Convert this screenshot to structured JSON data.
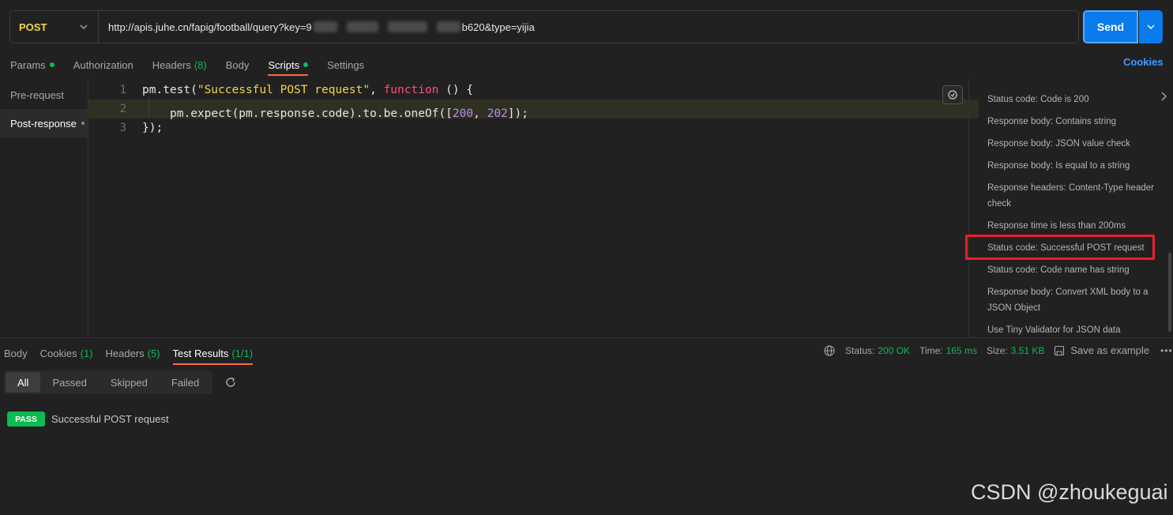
{
  "request": {
    "method": "POST",
    "url_prefix": "http://apis.juhe.cn/fapig/football/query?key=9",
    "url_suffix": "b620&type=yijia",
    "send_label": "Send"
  },
  "request_tabs": {
    "params": "Params",
    "authorization": "Authorization",
    "headers": "Headers",
    "headers_count": "(8)",
    "body": "Body",
    "scripts": "Scripts",
    "settings": "Settings",
    "cookies": "Cookies"
  },
  "scripts_sidebar": {
    "pre_request": "Pre-request",
    "post_response": "Post-response"
  },
  "code": {
    "lines": [
      "1",
      "2",
      "3"
    ],
    "l1_a": "pm.test(",
    "l1_str": "\"Successful POST request\"",
    "l1_b": ", ",
    "l1_kw": "function",
    "l1_c": " () {",
    "l2_a": "pm.expect(pm.response.code).to.be.oneOf([",
    "l2_n1": "200",
    "l2_b": ", ",
    "l2_n2": "202",
    "l2_c": "]);",
    "l3": "});"
  },
  "snippets": [
    "Status code: Code is 200",
    "Response body: Contains string",
    "Response body: JSON value check",
    "Response body: Is equal to a string",
    "Response headers: Content-Type header check",
    "Response time is less than 200ms",
    "Status code: Successful POST request",
    "Status code: Code name has string",
    "Response body: Convert XML body to a JSON Object",
    "Use Tiny Validator for JSON data"
  ],
  "response_tabs": {
    "body": "Body",
    "cookies": "Cookies",
    "cookies_count": "(1)",
    "headers": "Headers",
    "headers_count": "(5)",
    "test_results": "Test Results",
    "test_results_count": "(1/1)"
  },
  "response_meta": {
    "status_label": "Status:",
    "status": "200 OK",
    "time_label": "Time:",
    "time": "165 ms",
    "size_label": "Size:",
    "size": "3.51 KB",
    "save": "Save as example"
  },
  "filters": [
    "All",
    "Passed",
    "Skipped",
    "Failed"
  ],
  "test_result": {
    "badge": "PASS",
    "name": "Successful POST request"
  },
  "watermark": "CSDN @zhoukeguai",
  "colors": {
    "background": "#212121",
    "accent_blue": "#097bed",
    "success_green": "#0cbb52",
    "tab_underline": "#ff6c37",
    "method_yellow": "#f5d547",
    "highlight_red": "#e8202a"
  }
}
